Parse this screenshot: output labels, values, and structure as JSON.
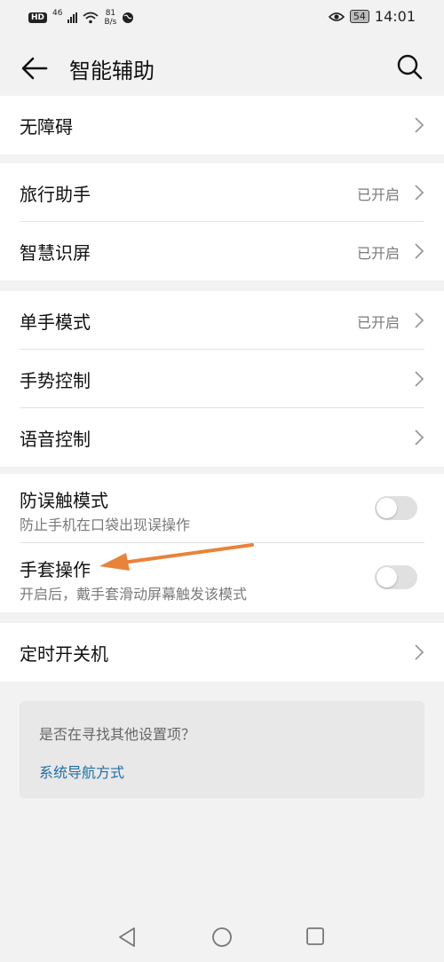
{
  "status_bar": {
    "hd": "HD",
    "network": "46",
    "speed_value": "81",
    "speed_unit": "B/s",
    "battery": "54",
    "time": "14:01"
  },
  "appbar": {
    "title": "智能辅助"
  },
  "groups": [
    {
      "items": [
        {
          "label": "无障碍",
          "status": ""
        }
      ]
    },
    {
      "items": [
        {
          "label": "旅行助手",
          "status": "已开启"
        },
        {
          "label": "智慧识屏",
          "status": "已开启"
        }
      ]
    },
    {
      "items": [
        {
          "label": "单手模式",
          "status": "已开启"
        },
        {
          "label": "手势控制",
          "status": ""
        },
        {
          "label": "语音控制",
          "status": ""
        }
      ]
    },
    {
      "items": [
        {
          "label": "防误触模式",
          "sub": "防止手机在口袋出现误操作",
          "toggle": false
        },
        {
          "label": "手套操作",
          "sub": "开启后，戴手套滑动屏幕触发该模式",
          "toggle": false
        }
      ]
    },
    {
      "items": [
        {
          "label": "定时开关机",
          "status": ""
        }
      ]
    }
  ],
  "hint": {
    "question": "是否在寻找其他设置项？",
    "link": "系统导航方式"
  },
  "colors": {
    "background": "#f2f2f2",
    "card": "#ffffff",
    "link": "#1f6fa8",
    "annotation_arrow": "#e8833a"
  }
}
